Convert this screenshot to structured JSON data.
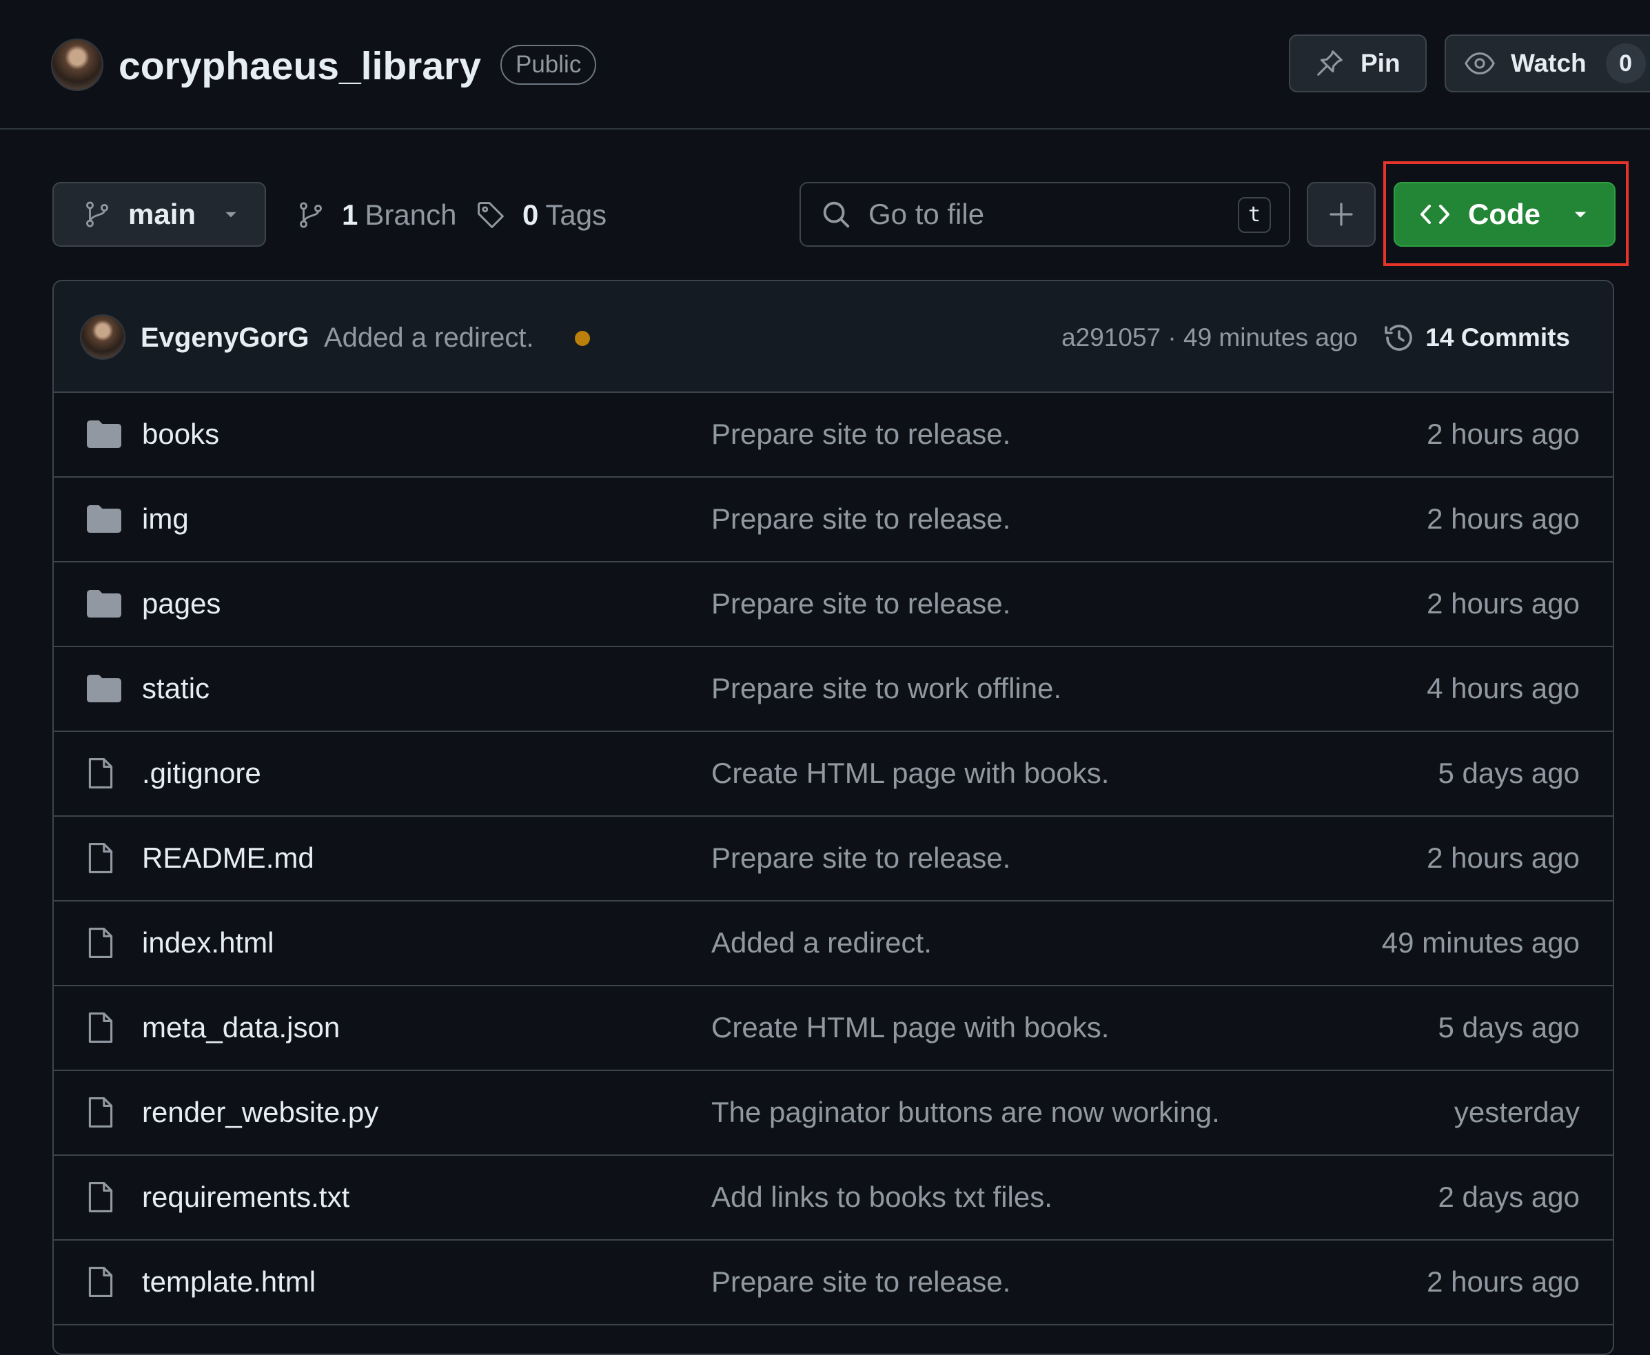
{
  "repo": {
    "name": "coryphaeus_library",
    "visibility": "Public"
  },
  "header_actions": {
    "pin_label": "Pin",
    "watch_label": "Watch",
    "watch_count": "0"
  },
  "toolbar": {
    "branch": "main",
    "branch_count": "1",
    "branch_label": "Branch",
    "tag_count": "0",
    "tag_label": "Tags",
    "search_placeholder": "Go to file",
    "search_shortcut": "t",
    "code_label": "Code"
  },
  "latest_commit": {
    "author": "EvgenyGorG",
    "message": "Added a redirect.",
    "meta": "a291057 · 49 minutes ago",
    "commits_label": "14 Commits"
  },
  "files": [
    {
      "name": "books",
      "type": "folder",
      "icon": "folder-icon",
      "commit": "Prepare site to release.",
      "time": "2 hours ago"
    },
    {
      "name": "img",
      "type": "folder",
      "icon": "folder-icon",
      "commit": "Prepare site to release.",
      "time": "2 hours ago"
    },
    {
      "name": "pages",
      "type": "folder",
      "icon": "folder-icon",
      "commit": "Prepare site to release.",
      "time": "2 hours ago"
    },
    {
      "name": "static",
      "type": "folder",
      "icon": "folder-icon",
      "commit": "Prepare site to work offline.",
      "time": "4 hours ago"
    },
    {
      "name": ".gitignore",
      "type": "file",
      "icon": "file-icon",
      "commit": "Create HTML page with books.",
      "time": "5 days ago"
    },
    {
      "name": "README.md",
      "type": "file",
      "icon": "file-icon",
      "commit": "Prepare site to release.",
      "time": "2 hours ago"
    },
    {
      "name": "index.html",
      "type": "file",
      "icon": "file-icon",
      "commit": "Added a redirect.",
      "time": "49 minutes ago"
    },
    {
      "name": "meta_data.json",
      "type": "file",
      "icon": "file-icon",
      "commit": "Create HTML page with books.",
      "time": "5 days ago"
    },
    {
      "name": "render_website.py",
      "type": "file",
      "icon": "file-icon",
      "commit": "The paginator buttons are now working.",
      "time": "yesterday"
    },
    {
      "name": "requirements.txt",
      "type": "file",
      "icon": "file-icon",
      "commit": "Add links to books txt files.",
      "time": "2 days ago"
    },
    {
      "name": "template.html",
      "type": "file",
      "icon": "file-icon",
      "commit": "Prepare site to release.",
      "time": "2 hours ago"
    }
  ],
  "colors": {
    "background": "#0d1117",
    "code_button": "#238636",
    "highlight_box": "#e5352b",
    "status_dot": "#bb8009"
  }
}
